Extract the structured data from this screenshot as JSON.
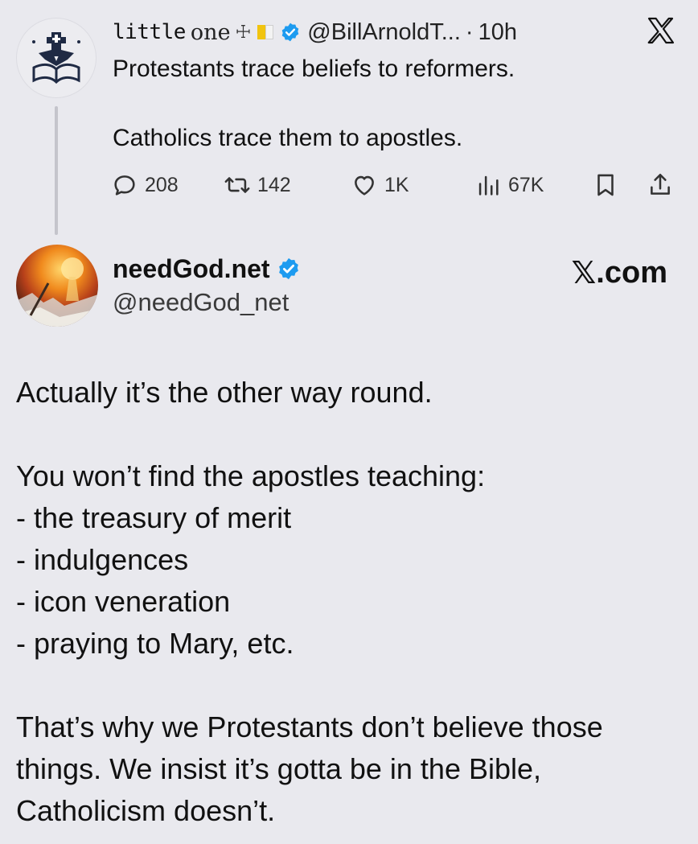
{
  "parent_tweet": {
    "display_name": "little",
    "display_name_word": "one",
    "display_name_glyph": "☩",
    "handle": "@BillArnoldT...",
    "time_separator": "·",
    "time": "10h",
    "lines": [
      "Protestants trace beliefs to reformers.",
      "Catholics trace them to apostles."
    ],
    "actions": {
      "replies": "208",
      "reposts": "142",
      "likes": "1K",
      "views": "67K"
    }
  },
  "main_tweet": {
    "display_name": "needGod.net",
    "handle": "@needGod_net",
    "paragraphs": [
      [
        "Actually it’s the other way round."
      ],
      [
        "You won’t find the apostles teaching:",
        "- the treasury of merit",
        "- indulgences",
        "- icon veneration",
        "- praying to Mary, etc."
      ],
      [
        "That’s why we Protestants don’t believe those",
        "things. We insist it’s gotta be in the Bible,",
        "Catholicism doesn’t."
      ]
    ]
  },
  "watermark": {
    "x_glyph": "𝕏",
    "text": ".com"
  },
  "colors": {
    "background": "#e9e9ee",
    "verified_blue": "#1d9bf0",
    "thread_line": "#c4c4cb"
  },
  "icons": [
    "church-book-logo-icon",
    "verified-badge-icon",
    "x-logo-icon",
    "reply-icon",
    "repost-icon",
    "like-icon",
    "views-icon",
    "bookmark-icon",
    "share-icon"
  ]
}
